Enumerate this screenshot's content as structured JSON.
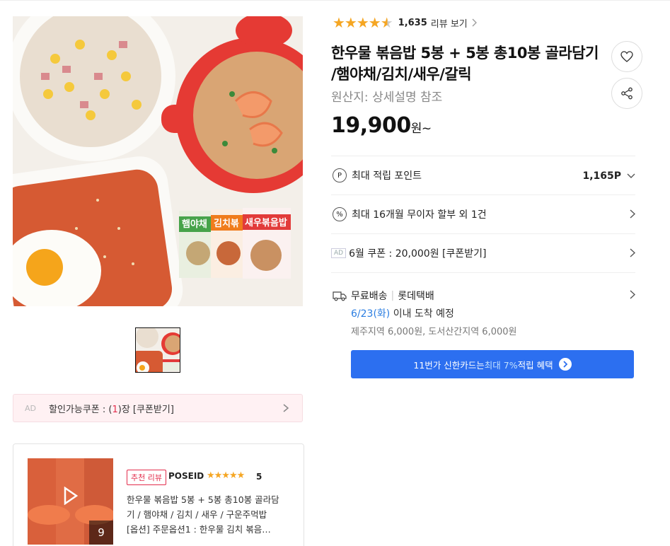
{
  "product": {
    "rating": {
      "stars": 4.5,
      "count": "1,635",
      "link_label": "리뷰 보기"
    },
    "title": "한우물 볶음밥 5봉 + 5봉 총10봉 골라담기 /햄야채/김치/새우/갈릭",
    "origin_label": "원산지:",
    "origin_value": "상세설명 참조",
    "price": "19,900",
    "price_unit": "원~",
    "pkg_labels": [
      "햄야채",
      "김치볶",
      "새우볶음밥"
    ]
  },
  "benefits": {
    "points_label": "최대 적립 포인트",
    "points_value": "1,165P",
    "installment_label": "최대 16개월 무이자 할부 외 1건",
    "coupon_ad": "AD",
    "coupon_label": "6월 쿠폰 : 20,000원 [쿠폰받기]"
  },
  "shipping": {
    "free_label": "무료배송",
    "carrier": "롯데택배",
    "date": "6/23(화)",
    "date_suffix": " 이내 도착 예정",
    "extra": "제주지역 6,000원, 도서산간지역 6,000원"
  },
  "card_banner": {
    "prefix": "11번가 신한카드는 ",
    "highlight": "최대 7%",
    "suffix": " 적립 혜택"
  },
  "discount_coupon": {
    "ad": "AD",
    "prefix": "할인가능쿠폰 : (",
    "count": "1",
    "suffix": ")장 [쿠폰받기]"
  },
  "review": {
    "badge": "추천 리뷰",
    "user": "POSEID",
    "stars": "★★★★★",
    "score": "5",
    "image_count": "9",
    "lines": [
      "한우물 볶음밥 5봉 + 5봉 총10봉 골라담",
      "기 / 햄야채 / 김치 / 새우 / 구운주먹밥",
      "[옵션] 주문옵션1 : 한우물 김치 볶음…"
    ]
  },
  "colors": {
    "accent_blue": "#2c6ff0",
    "star": "#f5a623",
    "coupon_red": "#e32d4c"
  }
}
